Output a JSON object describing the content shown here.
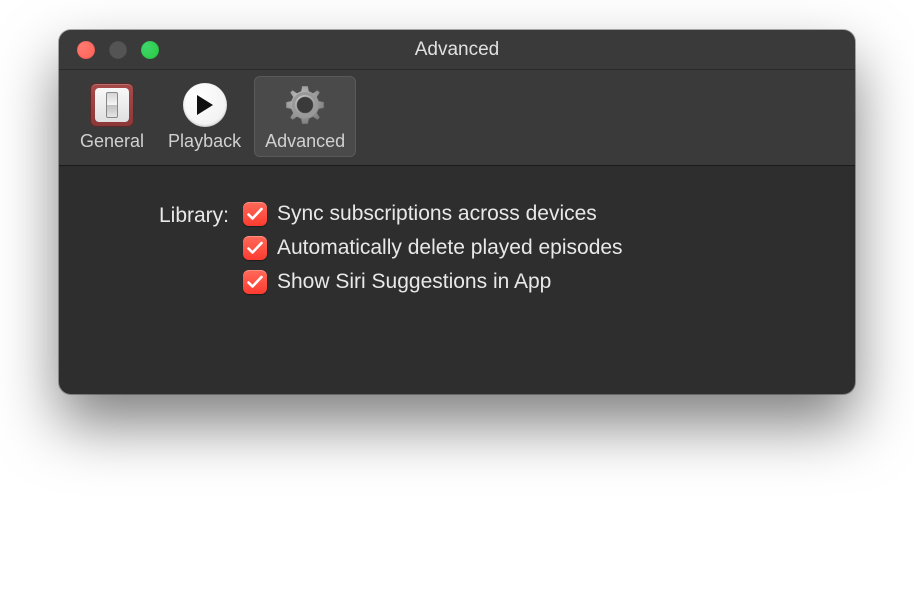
{
  "window": {
    "title": "Advanced"
  },
  "toolbar": {
    "items": [
      {
        "label": "General"
      },
      {
        "label": "Playback"
      },
      {
        "label": "Advanced"
      }
    ]
  },
  "content": {
    "library_label": "Library:",
    "options": [
      {
        "label": "Sync subscriptions across devices",
        "checked": true
      },
      {
        "label": "Automatically delete played episodes",
        "checked": true
      },
      {
        "label": "Show Siri Suggestions in App",
        "checked": true
      }
    ]
  }
}
